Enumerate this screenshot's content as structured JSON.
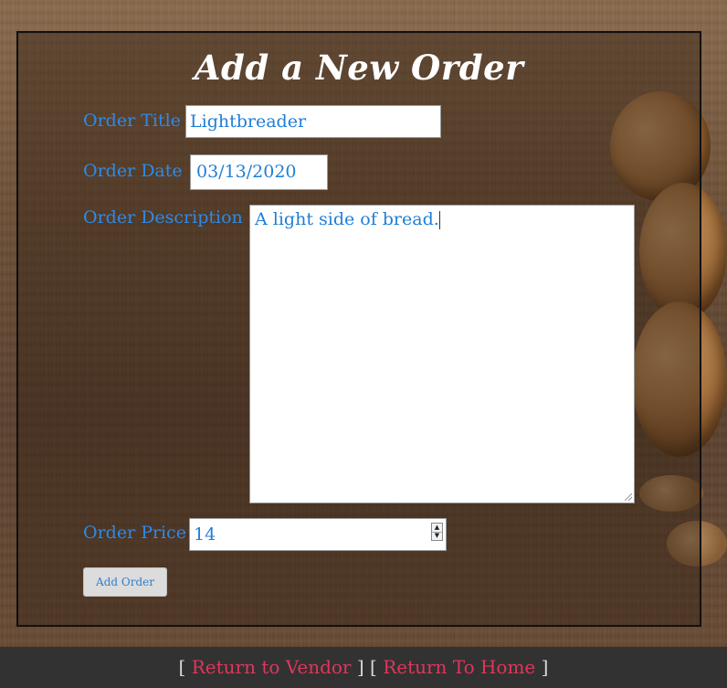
{
  "page": {
    "title": "Add a New Order"
  },
  "form": {
    "title_label": "Order Title",
    "title_value": "Lightbreader",
    "date_label": "Order Date",
    "date_value": "03/13/2020",
    "description_label": "Order Description",
    "description_value": "A light side of bread.",
    "price_label": "Order Price",
    "price_value": "14",
    "submit_label": "Add Order"
  },
  "footer": {
    "open_bracket_1": "[",
    "close_bracket_1": "]",
    "open_bracket_2": "[",
    "close_bracket_2": "]",
    "vendor_link": "Return to Vendor",
    "home_link": "Return To Home"
  },
  "colors": {
    "label_blue": "#2f8ae6",
    "link_pink": "#e0365c",
    "footer_bg": "#323232"
  },
  "icons": {
    "stepper_up": "triangle-up",
    "stepper_down": "triangle-down"
  }
}
